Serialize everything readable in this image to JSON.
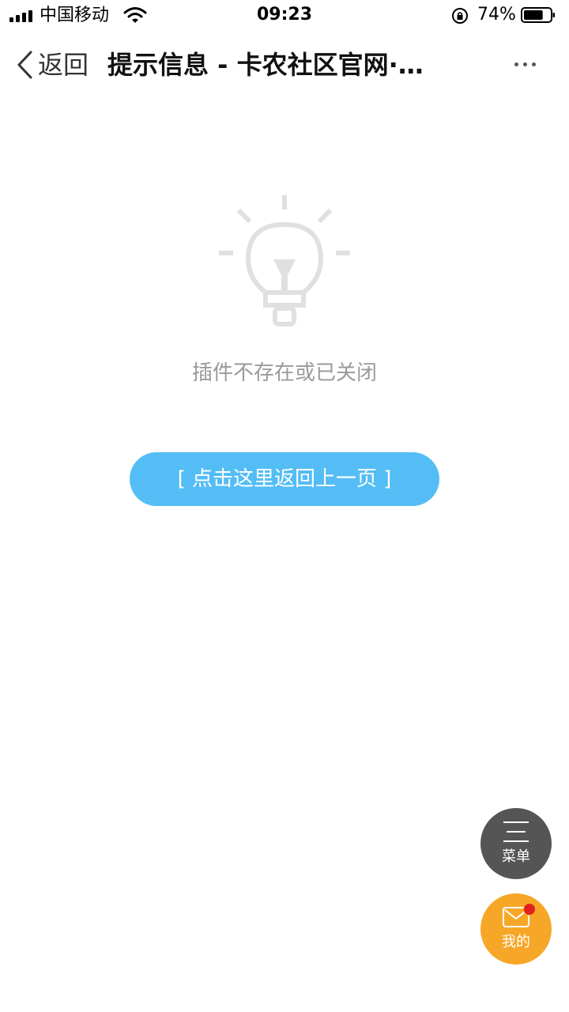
{
  "status_bar": {
    "carrier": "中国移动",
    "time": "09:23",
    "battery_percent": "74%",
    "battery_level": 0.74
  },
  "nav": {
    "back_label": "返回",
    "title": "提示信息 - 卡农社区官网·…",
    "more_icon": "more-dots-icon"
  },
  "content": {
    "icon": "light-bulb-icon",
    "message": "插件不存在或已关闭",
    "return_button_label": "[ 点击这里返回上一页 ]",
    "button_color": "#54bdf5"
  },
  "floating": {
    "menu_label": "菜单",
    "menu_icon": "menu-lines-icon",
    "mine_label": "我的",
    "mine_icon": "envelope-icon",
    "menu_color": "#555555",
    "mine_color": "#f7a727",
    "badge_color": "#e02020"
  }
}
